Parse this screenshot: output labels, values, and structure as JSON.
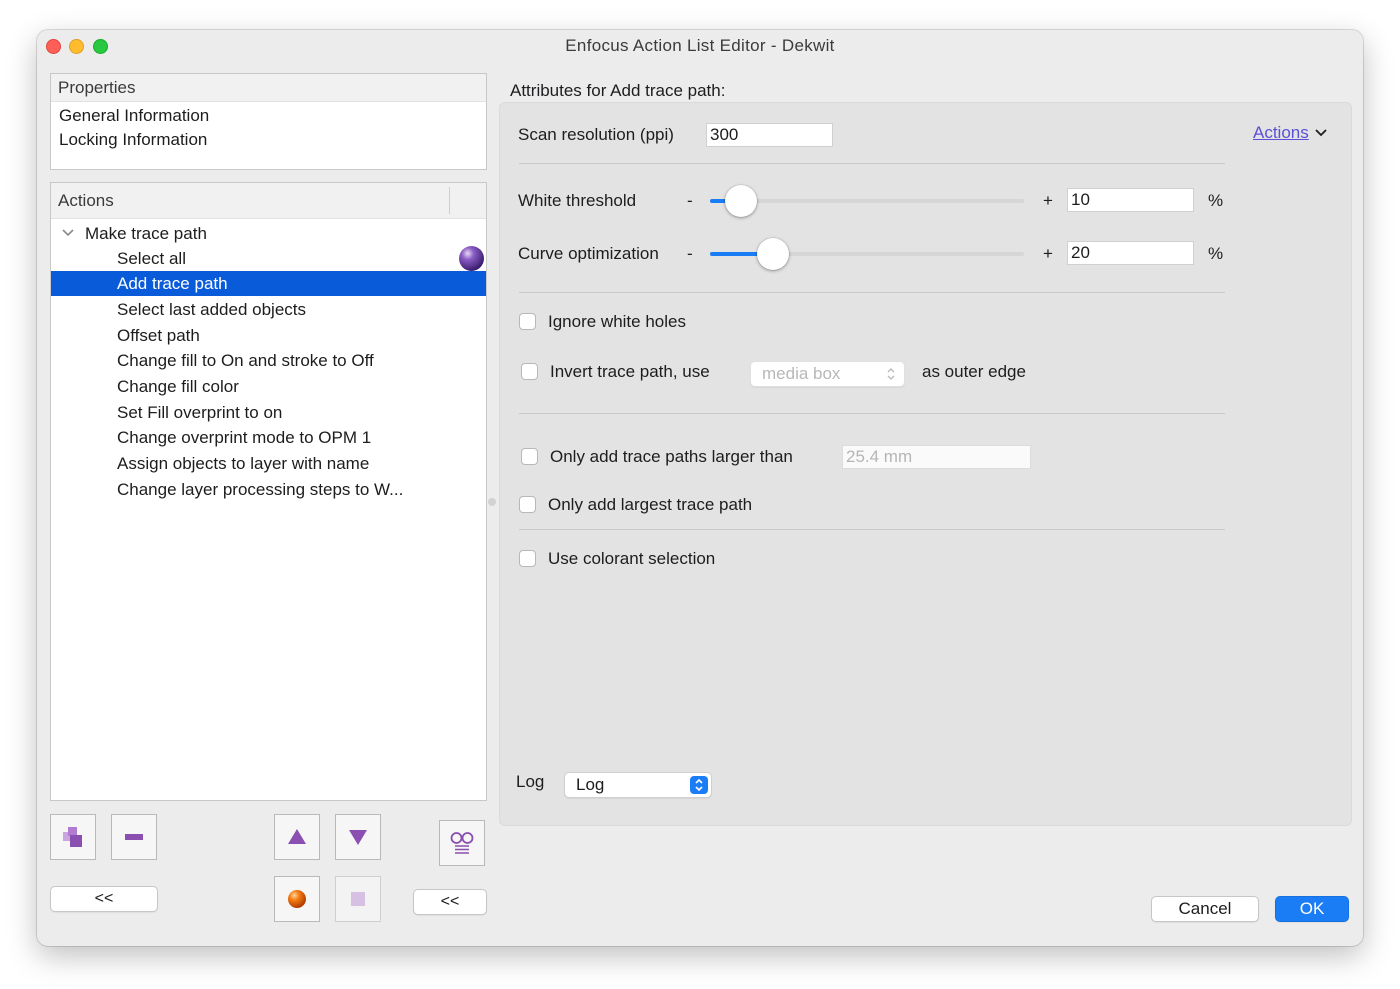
{
  "window": {
    "title": "Enfocus Action List Editor - Dekwit"
  },
  "properties_panel": {
    "header": "Properties",
    "items": [
      "General Information",
      "Locking Information"
    ]
  },
  "actions_panel": {
    "header": "Actions",
    "group_label": "Make trace path",
    "items": [
      "Select all",
      "Add trace path",
      "Select last added objects",
      "Offset path",
      "Change fill to On and stroke to Off",
      "Change fill color",
      "Set Fill overprint to on",
      "Change overprint mode to OPM 1",
      "Assign objects to layer with name",
      "Change layer processing steps to W..."
    ],
    "selected_item": "Add trace path"
  },
  "left_buttons": {
    "collapse_left": "<<",
    "collapse_right": "<<"
  },
  "attributes": {
    "heading": "Attributes for Add trace path:",
    "actions_menu": "Actions",
    "scan_resolution": {
      "label": "Scan resolution (ppi)",
      "value": "300"
    },
    "white_threshold": {
      "label": "White threshold",
      "minus": "-",
      "plus": "+",
      "value": "10",
      "unit": "%",
      "level": 0.1
    },
    "curve_optimization": {
      "label": "Curve optimization",
      "minus": "-",
      "plus": "+",
      "value": "20",
      "unit": "%",
      "level": 0.2
    },
    "ignore_white_holes": "Ignore white holes",
    "invert_trace": {
      "label": "Invert trace path, use",
      "select_value": "media box",
      "suffix": "as outer edge"
    },
    "only_larger": {
      "label": "Only add trace paths larger than",
      "placeholder": "25.4 mm"
    },
    "only_largest": "Only add largest trace path",
    "use_colorant": "Use colorant selection",
    "log": {
      "label": "Log",
      "value": "Log"
    }
  },
  "dialog_buttons": {
    "cancel": "Cancel",
    "ok": "OK"
  },
  "colors": {
    "accent": "#0a5bd9",
    "slider_fill": "#1b7df5",
    "link": "#5b4fd6",
    "icon_purple": "#8a4fb0"
  }
}
